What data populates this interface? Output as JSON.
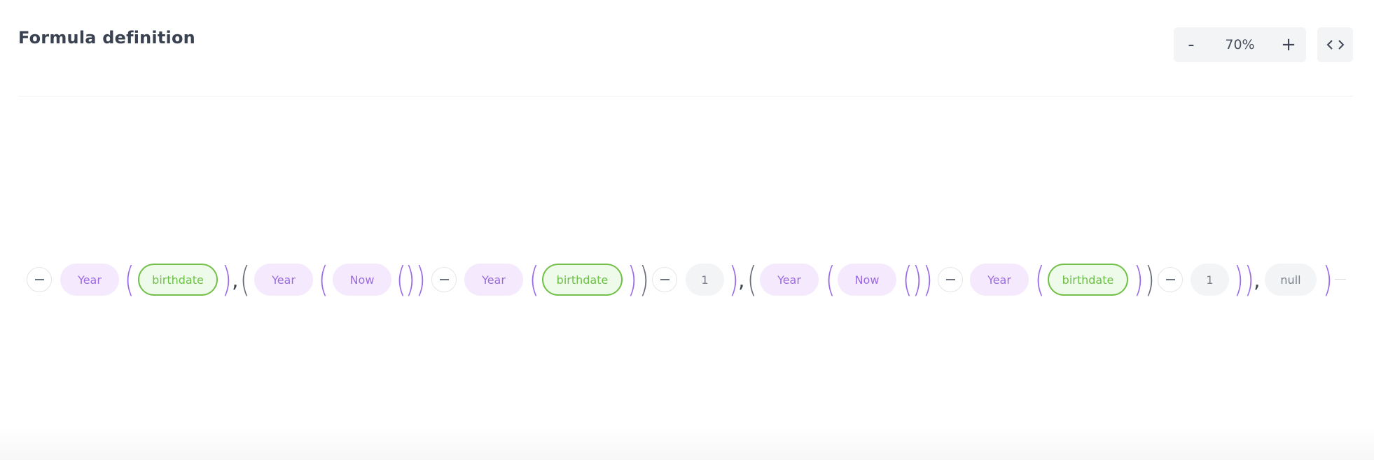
{
  "header": {
    "title": "Formula definition"
  },
  "zoom_controls": {
    "decrease_label": "-",
    "value": "70%",
    "increase_label": "+",
    "code_view_icon": "code-brackets-icon"
  },
  "formula": {
    "fn_year": "Year",
    "fn_now": "Now",
    "field_birthdate": "birthdate",
    "literal_one": "1",
    "literal_null": "null",
    "open_paren": "(",
    "close_paren": ")",
    "comma": ",",
    "colors": {
      "function": "#9c6ae0",
      "field": "#6cbf47",
      "literal": "#7b808a",
      "bracket_purple": "#9b6ce6",
      "bracket_gray": "#686e78"
    }
  }
}
